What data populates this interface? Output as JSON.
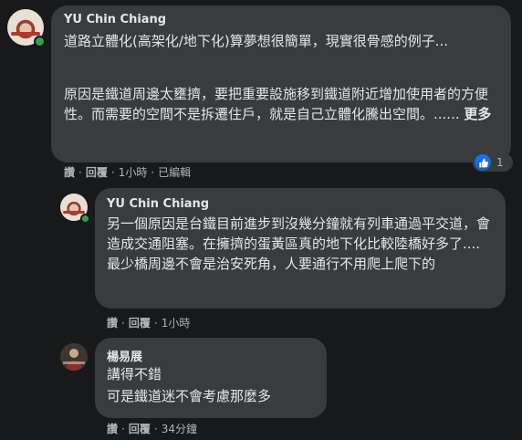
{
  "comments": [
    {
      "author": "YU Chin Chiang",
      "paragraph1": "道路立體化(高架化/地下化)算夢想很簡單，現實很骨感的例子...",
      "paragraph2": "原因是鐵道周邊太壅擠，要把重要設施移到鐵道附近增加使用者的方便性。而需要的空間不是拆遷住戶，就是自己立體化騰出空間。......",
      "see_more": "更多",
      "actions": {
        "like": "讚",
        "reply": "回覆",
        "time": "1小時",
        "edited": "已編輯"
      },
      "reaction_count": "1"
    },
    {
      "author": "YU Chin Chiang",
      "text": "另一個原因是台鐵目前進步到沒幾分鐘就有列車通過平交道，會造成交通阻塞。在擁擠的蛋黃區真的地下化比較陸橋好多了....最少橋周邊不會是治安死角，人要通行不用爬上爬下的",
      "actions": {
        "like": "讚",
        "reply": "回覆",
        "time": "1小時"
      }
    },
    {
      "author": "楊易展",
      "line1": "講得不錯",
      "line2": "可是鐵道迷不會考慮那麼多",
      "actions": {
        "like": "讚",
        "reply": "回覆",
        "time": "34分鐘"
      }
    }
  ],
  "icons": {
    "like": "thumbs-up-icon",
    "online": "online-status-icon"
  },
  "colors": {
    "bubble": "#3a3b3c",
    "background": "#18191a",
    "like_blue": "#1877f2",
    "online_green": "#31a24c"
  }
}
